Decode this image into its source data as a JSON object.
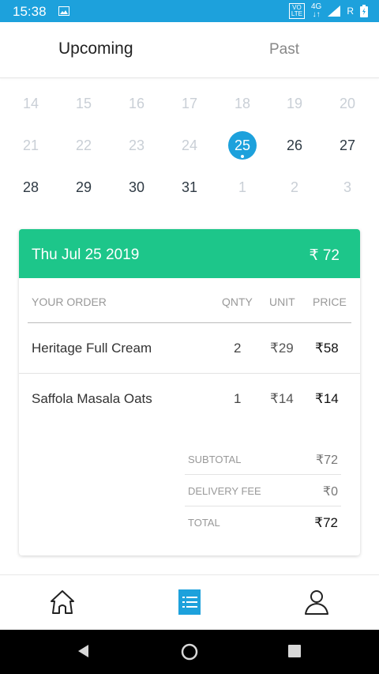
{
  "status_bar": {
    "time": "15:38",
    "volte_top": "VO",
    "volte_bottom": "LTE",
    "network_top": "4G",
    "network_bottom": "↓↑",
    "carrier": "R",
    "icons": [
      "image-icon",
      "signal-icon",
      "battery-icon"
    ]
  },
  "tabs": {
    "upcoming": "Upcoming",
    "past": "Past",
    "selected": "Upcoming"
  },
  "calendar": {
    "selected_day": "25",
    "rows": [
      [
        {
          "d": "14",
          "state": "muted"
        },
        {
          "d": "15",
          "state": "muted"
        },
        {
          "d": "16",
          "state": "muted"
        },
        {
          "d": "17",
          "state": "muted"
        },
        {
          "d": "18",
          "state": "muted"
        },
        {
          "d": "19",
          "state": "muted"
        },
        {
          "d": "20",
          "state": "muted"
        }
      ],
      [
        {
          "d": "21",
          "state": "muted"
        },
        {
          "d": "22",
          "state": "muted"
        },
        {
          "d": "23",
          "state": "muted"
        },
        {
          "d": "24",
          "state": "muted"
        },
        {
          "d": "25",
          "state": "selected"
        },
        {
          "d": "26",
          "state": "active"
        },
        {
          "d": "27",
          "state": "active"
        }
      ],
      [
        {
          "d": "28",
          "state": "active"
        },
        {
          "d": "29",
          "state": "active"
        },
        {
          "d": "30",
          "state": "active"
        },
        {
          "d": "31",
          "state": "active"
        },
        {
          "d": "1",
          "state": "muted"
        },
        {
          "d": "2",
          "state": "muted"
        },
        {
          "d": "3",
          "state": "muted"
        }
      ]
    ]
  },
  "order": {
    "date": "Thu Jul 25 2019",
    "total": "₹ 72",
    "headers": {
      "item": "YOUR ORDER",
      "qty": "QNTY",
      "unit": "UNIT",
      "price": "PRICE"
    },
    "items": [
      {
        "name": "Heritage Full Cream",
        "qty": "2",
        "unit": "₹29",
        "price": "₹58"
      },
      {
        "name": "Saffola Masala Oats",
        "qty": "1",
        "unit": "₹14",
        "price": "₹14"
      }
    ],
    "summary": {
      "subtotal_label": "SUBTOTAL",
      "subtotal": "₹72",
      "delivery_label": "DELIVERY FEE",
      "delivery": "₹0",
      "total_label": "TOTAL",
      "total": "₹72"
    }
  },
  "bottom_nav": {
    "items": [
      "home-icon",
      "orders-icon",
      "profile-icon"
    ],
    "active": "orders-icon"
  },
  "colors": {
    "accent_blue": "#1da1dc",
    "accent_green": "#1dc68a",
    "muted_text": "#c9cfd6"
  }
}
